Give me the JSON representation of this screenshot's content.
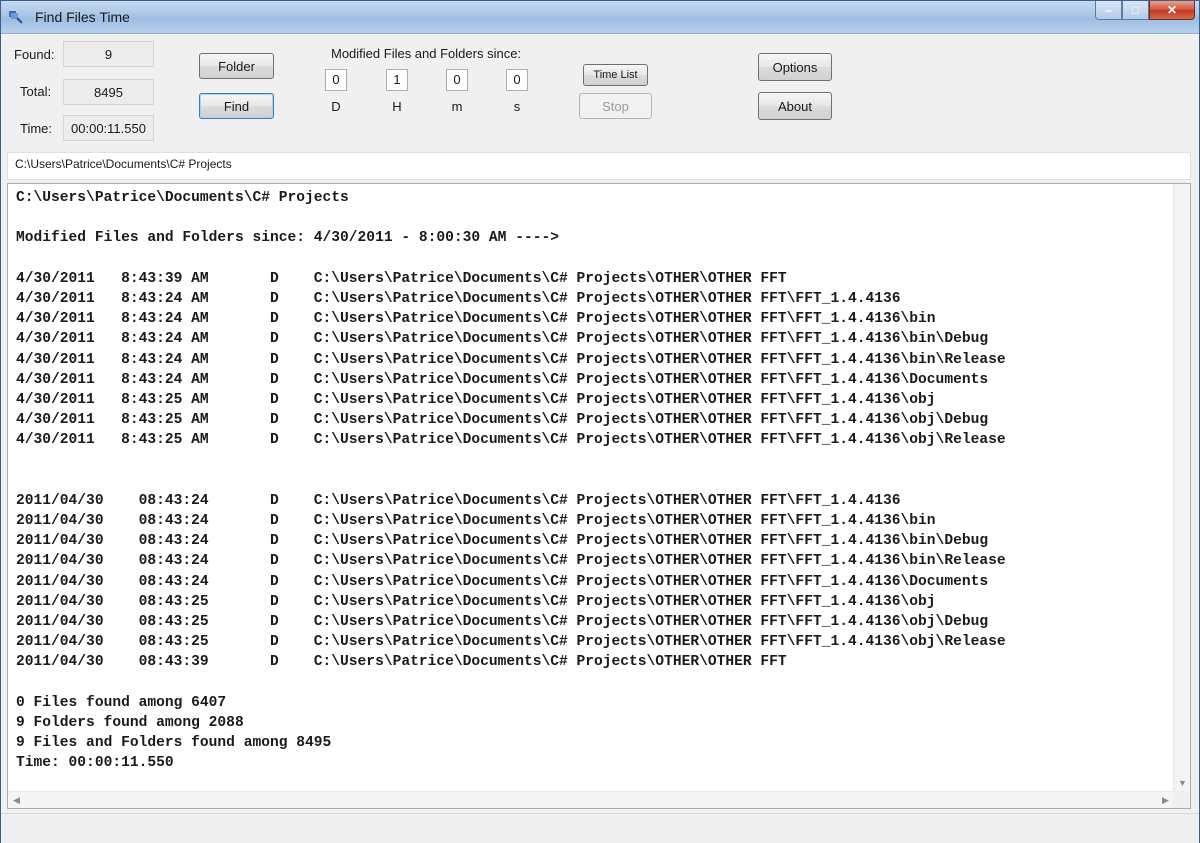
{
  "window": {
    "title": "Find Files Time",
    "icon": "app-icon",
    "controls": {
      "minimize": "–",
      "maximize": "□",
      "close": "✕"
    }
  },
  "stats": {
    "found_label": "Found:",
    "found_value": "9",
    "total_label": "Total:",
    "total_value": "8495",
    "time_label": "Time:",
    "time_value": "00:00:11.550"
  },
  "buttons": {
    "folder": "Folder",
    "find": "Find",
    "time_list": "Time List",
    "stop": "Stop",
    "options": "Options",
    "about": "About"
  },
  "since": {
    "heading": "Modified Files and Folders since:",
    "days": {
      "value": "0",
      "unit": "D"
    },
    "hours": {
      "value": "1",
      "unit": "H"
    },
    "minutes": {
      "value": "0",
      "unit": "m"
    },
    "seconds": {
      "value": "0",
      "unit": "s"
    }
  },
  "path": "C:\\Users\\Patrice\\Documents\\C# Projects",
  "output_lines": [
    "C:\\Users\\Patrice\\Documents\\C# Projects",
    "",
    "Modified Files and Folders since: 4/30/2011 - 8:00:30 AM ---->",
    "",
    "4/30/2011   8:43:39 AM       D    C:\\Users\\Patrice\\Documents\\C# Projects\\OTHER\\OTHER FFT",
    "4/30/2011   8:43:24 AM       D    C:\\Users\\Patrice\\Documents\\C# Projects\\OTHER\\OTHER FFT\\FFT_1.4.4136",
    "4/30/2011   8:43:24 AM       D    C:\\Users\\Patrice\\Documents\\C# Projects\\OTHER\\OTHER FFT\\FFT_1.4.4136\\bin",
    "4/30/2011   8:43:24 AM       D    C:\\Users\\Patrice\\Documents\\C# Projects\\OTHER\\OTHER FFT\\FFT_1.4.4136\\bin\\Debug",
    "4/30/2011   8:43:24 AM       D    C:\\Users\\Patrice\\Documents\\C# Projects\\OTHER\\OTHER FFT\\FFT_1.4.4136\\bin\\Release",
    "4/30/2011   8:43:24 AM       D    C:\\Users\\Patrice\\Documents\\C# Projects\\OTHER\\OTHER FFT\\FFT_1.4.4136\\Documents",
    "4/30/2011   8:43:25 AM       D    C:\\Users\\Patrice\\Documents\\C# Projects\\OTHER\\OTHER FFT\\FFT_1.4.4136\\obj",
    "4/30/2011   8:43:25 AM       D    C:\\Users\\Patrice\\Documents\\C# Projects\\OTHER\\OTHER FFT\\FFT_1.4.4136\\obj\\Debug",
    "4/30/2011   8:43:25 AM       D    C:\\Users\\Patrice\\Documents\\C# Projects\\OTHER\\OTHER FFT\\FFT_1.4.4136\\obj\\Release",
    "",
    "",
    "2011/04/30    08:43:24       D    C:\\Users\\Patrice\\Documents\\C# Projects\\OTHER\\OTHER FFT\\FFT_1.4.4136",
    "2011/04/30    08:43:24       D    C:\\Users\\Patrice\\Documents\\C# Projects\\OTHER\\OTHER FFT\\FFT_1.4.4136\\bin",
    "2011/04/30    08:43:24       D    C:\\Users\\Patrice\\Documents\\C# Projects\\OTHER\\OTHER FFT\\FFT_1.4.4136\\bin\\Debug",
    "2011/04/30    08:43:24       D    C:\\Users\\Patrice\\Documents\\C# Projects\\OTHER\\OTHER FFT\\FFT_1.4.4136\\bin\\Release",
    "2011/04/30    08:43:24       D    C:\\Users\\Patrice\\Documents\\C# Projects\\OTHER\\OTHER FFT\\FFT_1.4.4136\\Documents",
    "2011/04/30    08:43:25       D    C:\\Users\\Patrice\\Documents\\C# Projects\\OTHER\\OTHER FFT\\FFT_1.4.4136\\obj",
    "2011/04/30    08:43:25       D    C:\\Users\\Patrice\\Documents\\C# Projects\\OTHER\\OTHER FFT\\FFT_1.4.4136\\obj\\Debug",
    "2011/04/30    08:43:25       D    C:\\Users\\Patrice\\Documents\\C# Projects\\OTHER\\OTHER FFT\\FFT_1.4.4136\\obj\\Release",
    "2011/04/30    08:43:39       D    C:\\Users\\Patrice\\Documents\\C# Projects\\OTHER\\OTHER FFT",
    "",
    "0 Files found among 6407",
    "9 Folders found among 2088",
    "9 Files and Folders found among 8495",
    "Time: 00:00:11.550"
  ],
  "scrollbars": {
    "left_arrow": "◀",
    "right_arrow": "▶",
    "down_arrow": "▼"
  }
}
